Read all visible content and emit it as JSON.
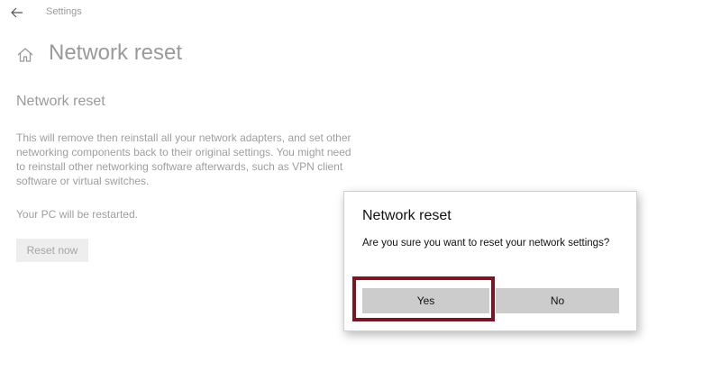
{
  "window": {
    "title": "Settings"
  },
  "icons": {
    "back": "arrow-left-icon",
    "home": "home-icon"
  },
  "page": {
    "title": "Network reset",
    "section_heading": "Network reset",
    "description": "This will remove then reinstall all your network adapters, and set other networking components back to their original settings. You might need to reinstall other networking software afterwards, such as VPN client software or virtual switches.",
    "restart_note": "Your PC will be restarted.",
    "reset_button_label": "Reset now"
  },
  "dialog": {
    "title": "Network reset",
    "message": "Are you sure you want to reset your network settings?",
    "yes_label": "Yes",
    "no_label": "No"
  },
  "colors": {
    "highlight_frame": "#7b1423",
    "dialog_button": "#cccccc",
    "dimmed_text": "#9a9a9a"
  }
}
